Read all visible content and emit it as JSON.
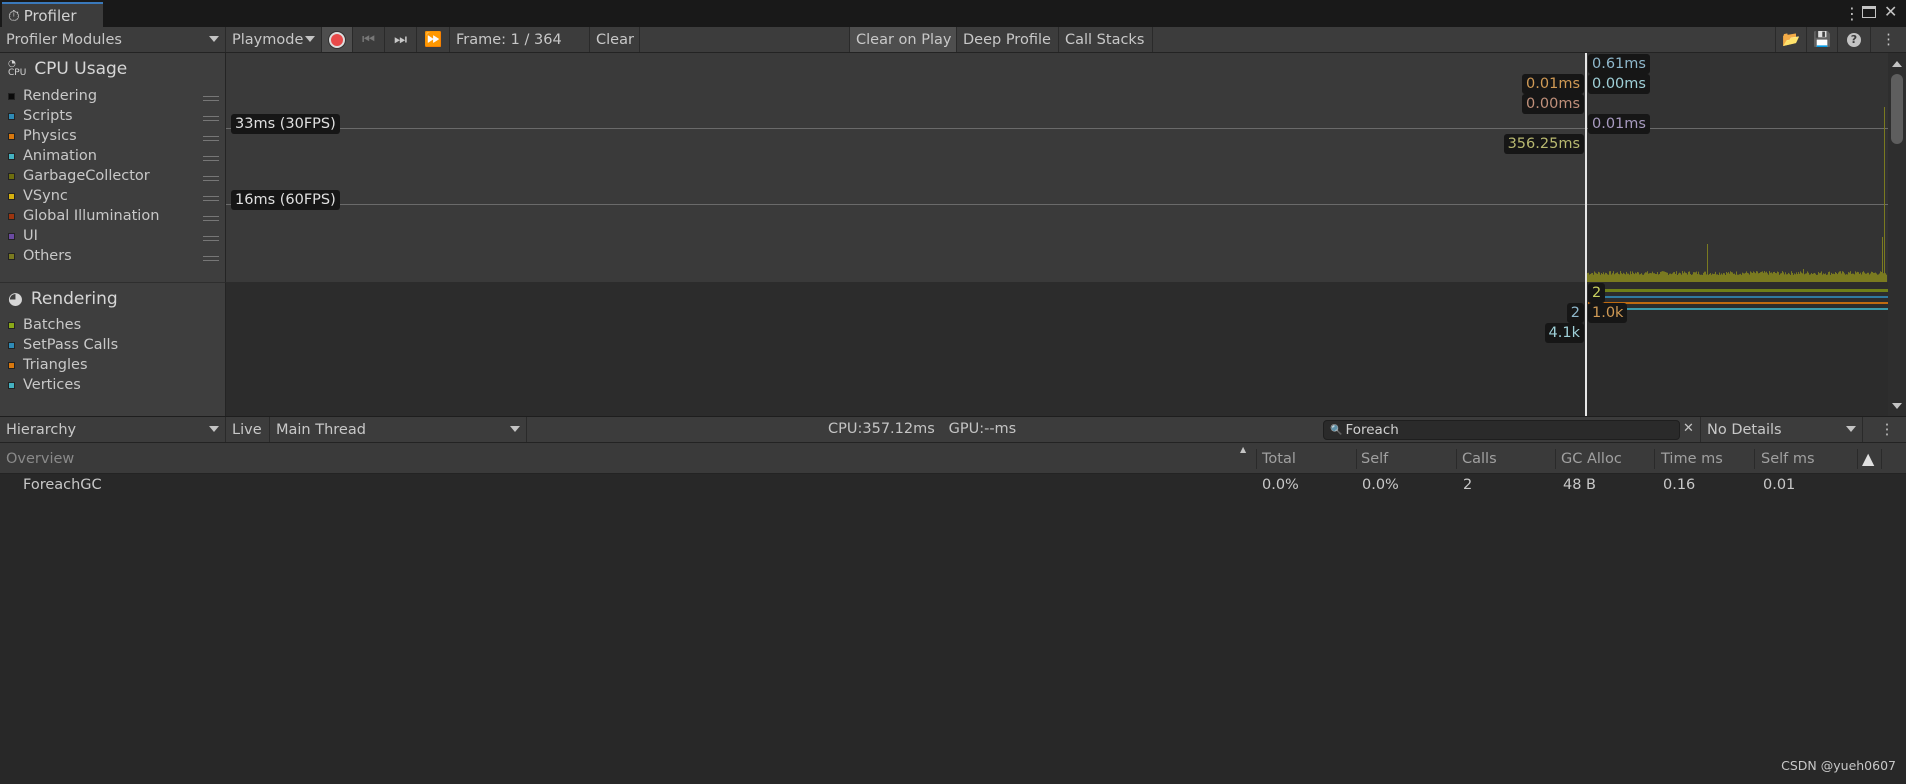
{
  "window": {
    "tab_title": "Profiler",
    "icons": [
      "kebab-menu-icon",
      "maximize-icon",
      "close-icon"
    ]
  },
  "toolbar": {
    "modules_label": "Profiler Modules",
    "target_label": "Playmode",
    "frame_label": "Frame: 1 / 364",
    "clear_label": "Clear",
    "clear_on_play_label": "Clear on Play",
    "deep_profile_label": "Deep Profile",
    "call_stacks_label": "Call Stacks",
    "record_color": "#e84a4a"
  },
  "cpu_module": {
    "title": "CPU Usage",
    "legend": [
      {
        "label": "Rendering",
        "color": "#0a0a0a"
      },
      {
        "label": "Scripts",
        "color": "#2f8ab5"
      },
      {
        "label": "Physics",
        "color": "#d8780f"
      },
      {
        "label": "Animation",
        "color": "#45b0c0"
      },
      {
        "label": "GarbageCollector",
        "color": "#6e6e10"
      },
      {
        "label": "VSync",
        "color": "#d4b010"
      },
      {
        "label": "Global Illumination",
        "color": "#9c3510"
      },
      {
        "label": "UI",
        "color": "#6a4aa0"
      },
      {
        "label": "Others",
        "color": "#7a7a20"
      }
    ],
    "lines": {
      "line_30fps": "33ms (30FPS)",
      "line_60fps": "16ms (60FPS)"
    },
    "labels": {
      "r1": "0.61ms",
      "r2": "0.00ms",
      "r3": "0.01ms",
      "l1": "0.01ms",
      "l2": "0.00ms",
      "l3": "356.25ms"
    }
  },
  "rendering_module": {
    "title": "Rendering",
    "legend": [
      {
        "label": "Batches",
        "color": "#8aa818"
      },
      {
        "label": "SetPass Calls",
        "color": "#2f8ab5"
      },
      {
        "label": "Triangles",
        "color": "#d8780f"
      },
      {
        "label": "Vertices",
        "color": "#45b0c0"
      }
    ],
    "labels": {
      "batches": "2",
      "setpass": "2",
      "triangles": "1.0k",
      "vertices": "4.1k"
    }
  },
  "hierarchy": {
    "view_label": "Hierarchy",
    "live_label": "Live",
    "thread_label": "Main Thread",
    "cpu_gpu": "CPU:357.12ms   GPU:--ms",
    "search_value": "Foreach",
    "details_label": "No Details",
    "columns": [
      "Overview",
      "Total",
      "Self",
      "Calls",
      "GC Alloc",
      "Time ms",
      "Self ms"
    ],
    "rows": [
      {
        "name": "ForeachGC",
        "total": "0.0%",
        "self": "0.0%",
        "calls": "2",
        "gc_alloc": "48 B",
        "time_ms": "0.16",
        "self_ms": "0.01"
      }
    ]
  },
  "watermark": "CSDN @yueh0607"
}
